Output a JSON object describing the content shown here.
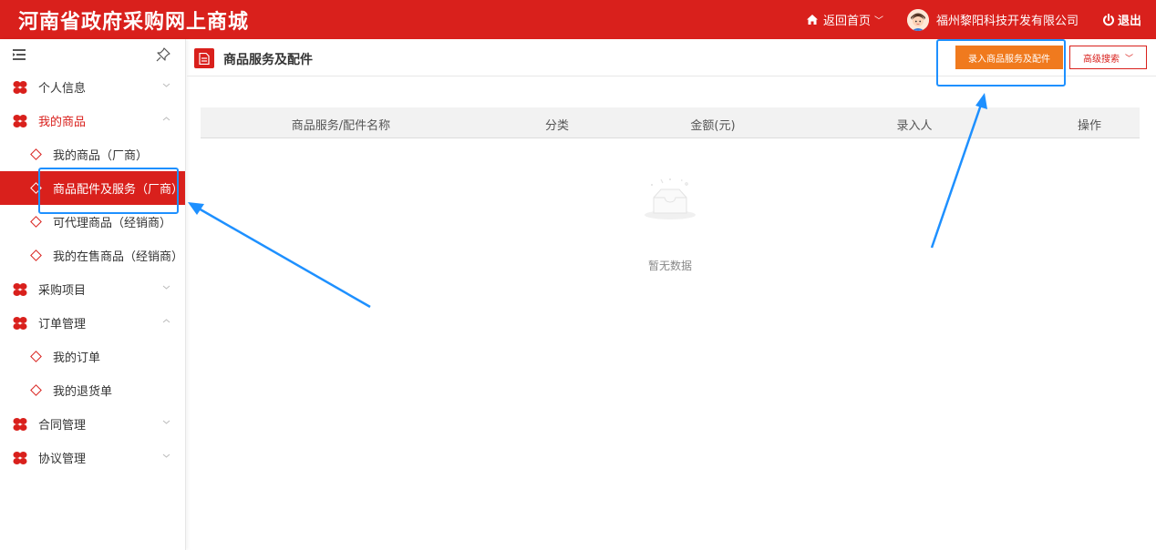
{
  "header": {
    "site_title": "河南省政府采购网上商城",
    "home_label": "返回首页",
    "company_name": "福州黎阳科技开发有限公司",
    "logout_label": "退出",
    "bg_color": "#d9201c"
  },
  "sidebar": {
    "groups": [
      {
        "label": "个人信息",
        "expanded": false,
        "icon": "clover-icon"
      },
      {
        "label": "我的商品",
        "expanded": true,
        "icon": "clover-icon",
        "items": [
          "我的商品（厂商）",
          "商品配件及服务（厂商）",
          "可代理商品（经销商）",
          "我的在售商品（经销商）"
        ]
      },
      {
        "label": "采购项目",
        "expanded": false,
        "icon": "clover-icon"
      },
      {
        "label": "订单管理",
        "expanded": true,
        "icon": "clover-icon",
        "items": [
          "我的订单",
          "我的退货单"
        ]
      },
      {
        "label": "合同管理",
        "expanded": false,
        "icon": "clover-icon"
      },
      {
        "label": "协议管理",
        "expanded": false,
        "icon": "clover-icon"
      }
    ],
    "active_item": "商品配件及服务（厂商）"
  },
  "main": {
    "title": "商品服务及配件",
    "add_button": "录入商品服务及配件",
    "advanced_search": "高级搜索",
    "columns": [
      "商品服务/配件名称",
      "分类",
      "金额(元)",
      "录入人",
      "操作"
    ],
    "empty_text": "暂无数据"
  },
  "colors": {
    "accent": "#d9201c",
    "add_button": "#f07a1e",
    "annotation": "#1e90ff"
  }
}
